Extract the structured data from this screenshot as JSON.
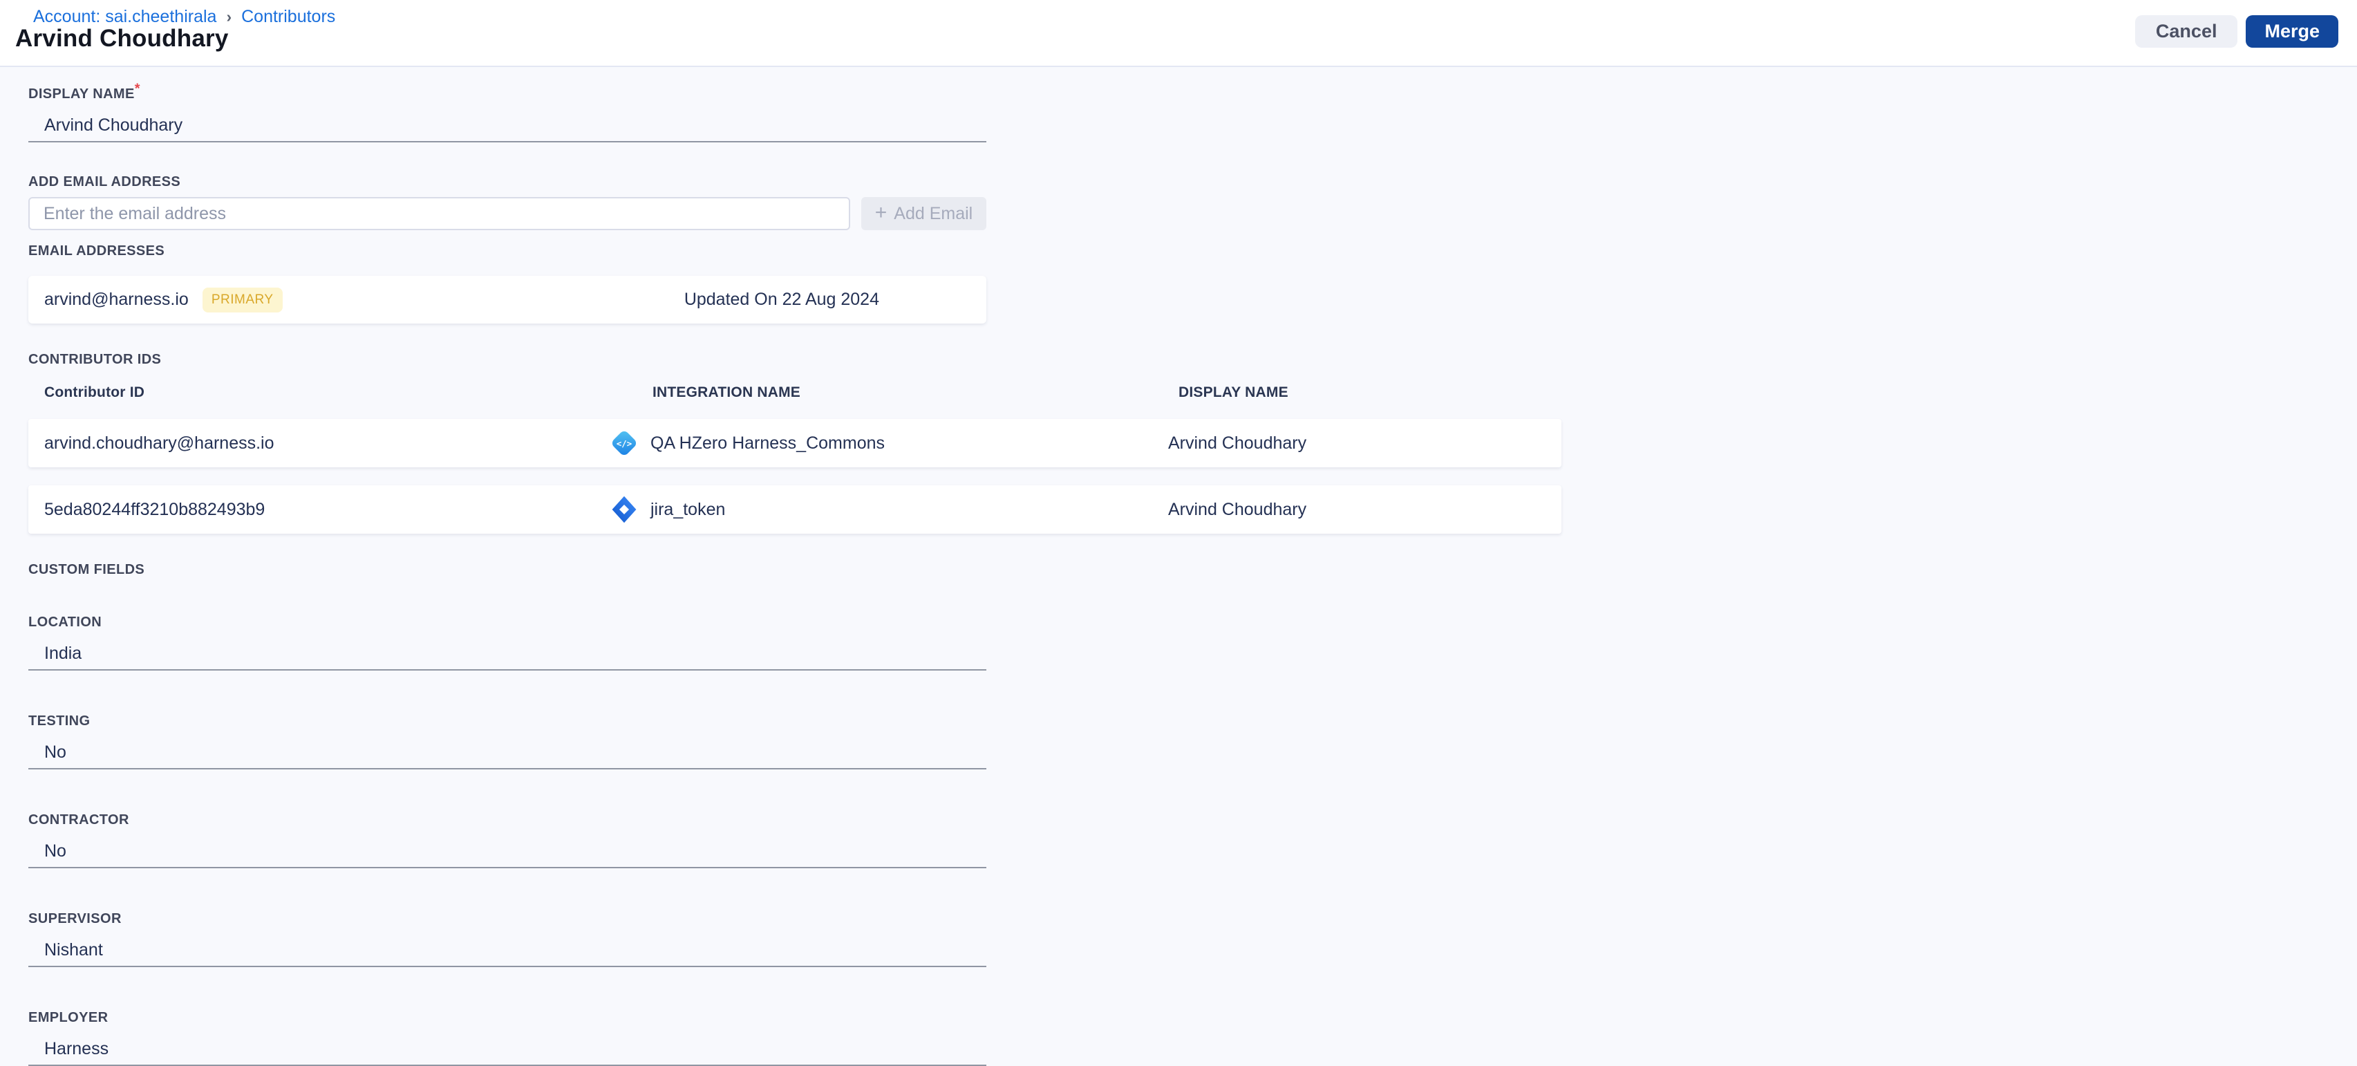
{
  "breadcrumb": {
    "account_link": "Account: sai.cheethirala",
    "separator": "›",
    "current": "Contributors"
  },
  "header": {
    "title": "Arvind Choudhary",
    "cancel_button": "Cancel",
    "merge_button": "Merge"
  },
  "display_name_field": {
    "label": "DISPLAY NAME",
    "required_mark": "*",
    "value": "Arvind Choudhary"
  },
  "add_email_section": {
    "label": "ADD EMAIL ADDRESS",
    "input_placeholder": "Enter the email address",
    "add_button": {
      "plus": "+",
      "label": "Add Email"
    }
  },
  "email_addresses_section": {
    "label": "EMAIL ADDRESSES",
    "rows": [
      {
        "email": "arvind@harness.io",
        "badge": "PRIMARY",
        "updated_on": "Updated On 22 Aug 2024"
      }
    ]
  },
  "contributor_ids_section": {
    "label": "CONTRIBUTOR IDS",
    "columns": {
      "id": "Contributor ID",
      "integration": "INTEGRATION NAME",
      "display_name": "DISPLAY NAME"
    },
    "rows": [
      {
        "contributor_id": "arvind.choudhary@harness.io",
        "integration_icon": "code-integration-icon",
        "integration_name": "QA HZero Harness_Commons",
        "display_name": "Arvind Choudhary"
      },
      {
        "contributor_id": "5eda80244ff3210b882493b9",
        "integration_icon": "jira-icon",
        "integration_name": "jira_token",
        "display_name": "Arvind Choudhary"
      }
    ]
  },
  "custom_fields_section": {
    "label": "CUSTOM FIELDS",
    "fields": [
      {
        "label": "LOCATION",
        "value": "India"
      },
      {
        "label": "TESTING",
        "value": "No"
      },
      {
        "label": "CONTRACTOR",
        "value": "No"
      },
      {
        "label": "SUPERVISOR",
        "value": "Nishant"
      },
      {
        "label": "EMPLOYER",
        "value": "Harness"
      }
    ]
  },
  "colors": {
    "merge_button_bg": "#12479c",
    "link_blue": "#1a6fdc",
    "badge_bg": "#fdf5d0",
    "badge_text": "#d9a82a",
    "page_bg": "#f8f9fd"
  }
}
